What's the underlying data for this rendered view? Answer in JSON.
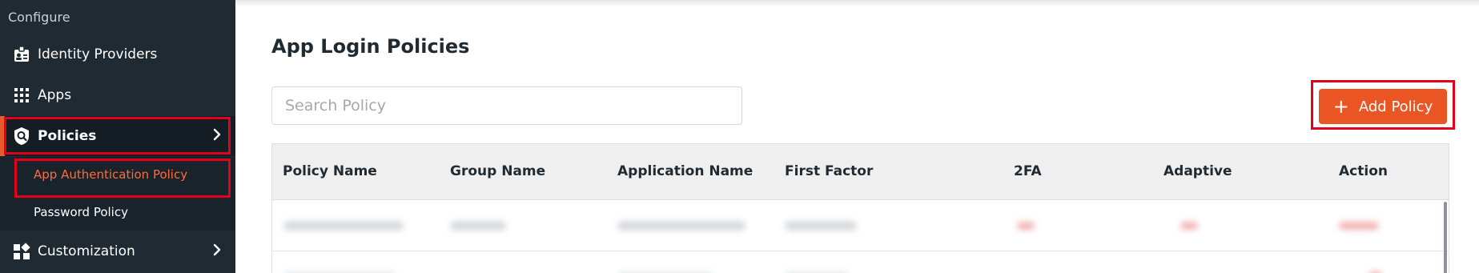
{
  "sidebar": {
    "section_label": "Configure",
    "items": [
      {
        "label": "Identity Providers",
        "icon": "id-badge-icon"
      },
      {
        "label": "Apps",
        "icon": "grid-icon"
      },
      {
        "label": "Policies",
        "icon": "shield-search-icon"
      },
      {
        "label": "Customization",
        "icon": "widgets-icon"
      }
    ],
    "sub_items": [
      {
        "label": "App Authentication Policy"
      },
      {
        "label": "Password Policy"
      }
    ]
  },
  "main": {
    "title": "App Login Policies",
    "search": {
      "placeholder": "Search Policy",
      "value": ""
    },
    "add_button": {
      "label": "Add Policy"
    },
    "table": {
      "columns": [
        "Policy Name",
        "Group Name",
        "Application Name",
        "First Factor",
        "2FA",
        "Adaptive",
        "Action"
      ]
    }
  },
  "colors": {
    "sidebar_bg": "#1f2a33",
    "accent": "#ea5524",
    "highlight_box": "#e3001b"
  }
}
